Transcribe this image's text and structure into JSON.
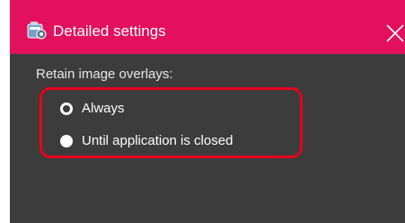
{
  "window": {
    "title": "Detailed settings",
    "app_icon": "settings-app-icon",
    "close_icon": "close-icon",
    "close_glyph": "✕"
  },
  "settings": {
    "section_label": "Retain image overlays:",
    "options": [
      {
        "label": "Always",
        "selected": true
      },
      {
        "label": "Until application is closed",
        "selected": false
      }
    ]
  },
  "colors": {
    "titlebar": "#e2105d",
    "background": "#3c3c3c",
    "highlight_outline": "#e8001b"
  }
}
